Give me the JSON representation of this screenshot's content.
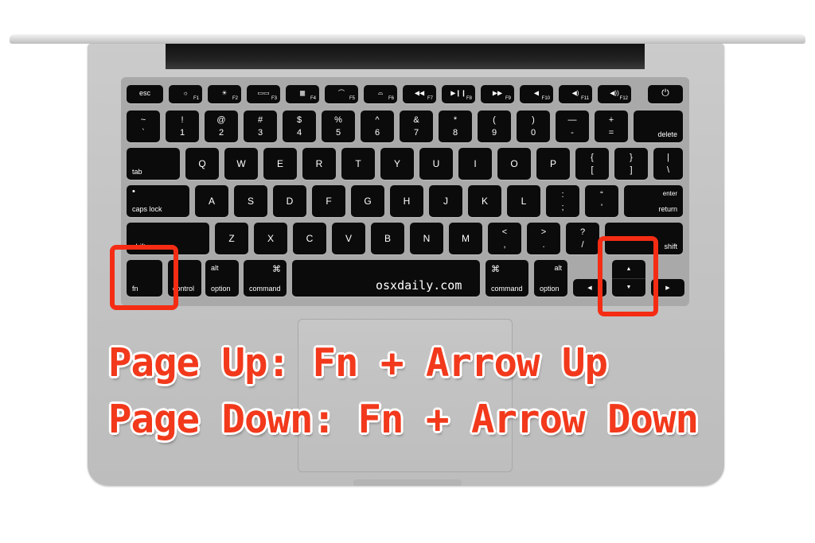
{
  "watermark": "osxdaily.com",
  "captions": [
    "Page Up: Fn + Arrow Up",
    "Page Down: Fn + Arrow Down"
  ],
  "highlight_color": "#f52c14",
  "caption_color": "#f2391c",
  "keys": {
    "esc": "esc",
    "f1": "F1",
    "f2": "F2",
    "f3": "F3",
    "f4": "F4",
    "f5": "F5",
    "f6": "F6",
    "f7": "F7",
    "f8": "F8",
    "f9": "F9",
    "f10": "F10",
    "f11": "F11",
    "f12": "F12",
    "power": "⏻",
    "num_row": [
      {
        "top": "~",
        "bottom": "`"
      },
      {
        "top": "!",
        "bottom": "1"
      },
      {
        "top": "@",
        "bottom": "2"
      },
      {
        "top": "#",
        "bottom": "3"
      },
      {
        "top": "$",
        "bottom": "4"
      },
      {
        "top": "%",
        "bottom": "5"
      },
      {
        "top": "^",
        "bottom": "6"
      },
      {
        "top": "&",
        "bottom": "7"
      },
      {
        "top": "*",
        "bottom": "8"
      },
      {
        "top": "(",
        "bottom": "9"
      },
      {
        "top": ")",
        "bottom": "0"
      },
      {
        "top": "—",
        "bottom": "-"
      },
      {
        "top": "+",
        "bottom": "="
      }
    ],
    "delete": "delete",
    "tab": "tab",
    "qwerty_row": [
      "Q",
      "W",
      "E",
      "R",
      "T",
      "Y",
      "U",
      "I",
      "O",
      "P"
    ],
    "brackets": [
      {
        "top": "{",
        "bottom": "["
      },
      {
        "top": "}",
        "bottom": "]"
      },
      {
        "top": "|",
        "bottom": "\\"
      }
    ],
    "caps_lock": "caps lock",
    "home_row": [
      "A",
      "S",
      "D",
      "F",
      "G",
      "H",
      "J",
      "K",
      "L"
    ],
    "home_punct": [
      {
        "top": ":",
        "bottom": ";"
      },
      {
        "top": "“",
        "bottom": "'"
      }
    ],
    "enter": "enter",
    "return": "return",
    "shift": "shift",
    "bottom_letters": [
      "Z",
      "X",
      "C",
      "V",
      "B",
      "N",
      "M"
    ],
    "bottom_punct": [
      {
        "top": "<",
        "bottom": ","
      },
      {
        "top": ">",
        "bottom": "."
      },
      {
        "top": "?",
        "bottom": "/"
      }
    ],
    "fn": "fn",
    "control": "control",
    "alt": "alt",
    "option": "option",
    "cmd_symbol": "⌘",
    "command": "command",
    "arrow_up": "▲",
    "arrow_down": "▼",
    "arrow_left": "◀",
    "arrow_right": "▶"
  }
}
